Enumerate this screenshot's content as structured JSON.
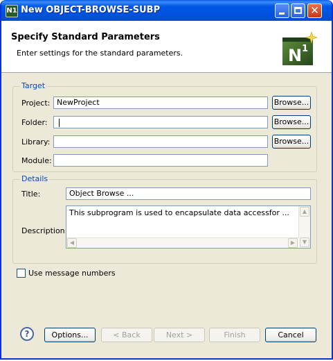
{
  "window": {
    "title": "New OBJECT-BROWSE-SUBP",
    "icon": "N1",
    "controls": {
      "minimize_icon": "minimize-icon",
      "maximize_icon": "maximize-icon",
      "close_icon": "close-icon",
      "close_glyph": "✕"
    }
  },
  "banner": {
    "title": "Specify Standard Parameters",
    "subtitle": "Enter settings for the standard parameters.",
    "logo_text": "N",
    "logo_sup": "1"
  },
  "target": {
    "legend": "Target",
    "project_label": "Project:",
    "project_value": "NewProject",
    "folder_label": "Folder:",
    "folder_value": "",
    "library_label": "Library:",
    "library_value": "",
    "module_label": "Module:",
    "module_value": "",
    "browse_label": "Browse..."
  },
  "details": {
    "legend": "Details",
    "title_label": "Title:",
    "title_value": "Object Browse ...",
    "description_label": "Description:",
    "description_value": "This subprogram is used to encapsulate data accessfor ..."
  },
  "options": {
    "use_message_numbers_label": "Use message numbers",
    "use_message_numbers_checked": false
  },
  "footer": {
    "help_glyph": "?",
    "options_label": "Options...",
    "back_label": "< Back",
    "next_label": "Next >",
    "finish_label": "Finish",
    "cancel_label": "Cancel"
  },
  "colors": {
    "titlebar": "#0058e7",
    "dialog_bg": "#ece9d8",
    "group_label": "#0046d5",
    "logo_green": "#3a6e2a"
  }
}
